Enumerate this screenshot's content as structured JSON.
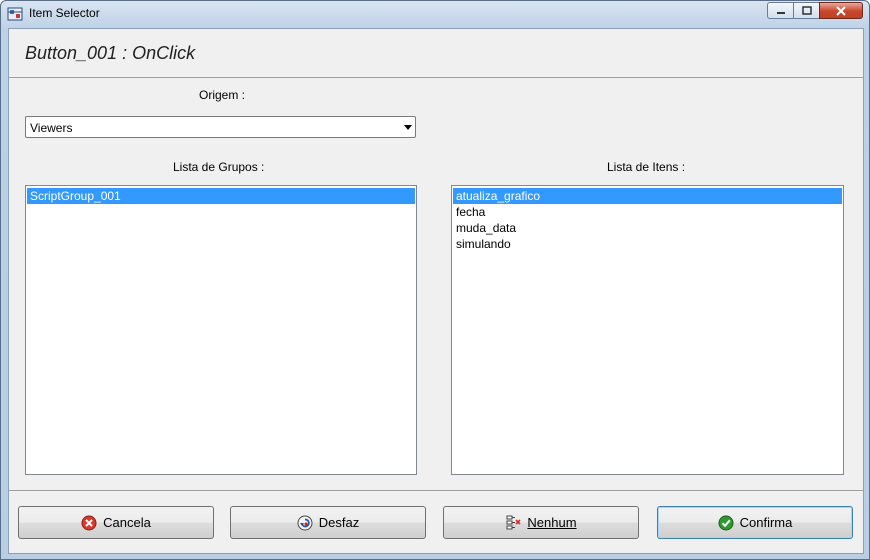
{
  "window": {
    "title": "Item Selector"
  },
  "header": {
    "title": "Button_001 : OnClick"
  },
  "origem": {
    "label": "Origem :",
    "selected": "Viewers"
  },
  "groups": {
    "label": "Lista de Grupos :",
    "items": [
      "ScriptGroup_001"
    ],
    "selected_index": 0
  },
  "items": {
    "label": "Lista de Itens :",
    "items": [
      "atualiza_grafico",
      "fecha",
      "muda_data",
      "simulando"
    ],
    "selected_index": 0
  },
  "buttons": {
    "cancel": "Cancela",
    "undo": "Desfaz",
    "none": "Nenhum",
    "confirm": "Confirma"
  },
  "colors": {
    "selection": "#3399ff",
    "cancel_icon": "#d93a2b",
    "confirm_icon": "#2e9a2e"
  },
  "icons": {
    "app": "item-selector-icon",
    "cancel": "cancel-icon",
    "undo": "undo-icon",
    "none": "clear-selection-icon",
    "confirm": "check-icon"
  }
}
